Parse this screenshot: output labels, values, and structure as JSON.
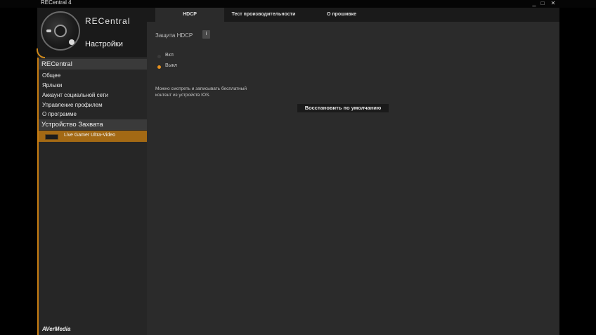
{
  "window": {
    "title": "RECentral 4",
    "minimize": "_",
    "maximize": "□",
    "close": "✕"
  },
  "sidebar": {
    "brand": "RECentral",
    "section_title": "Настройки",
    "group1": {
      "title": "RECentral",
      "items": [
        "Общее",
        "Ярлыки",
        "Аккаунт социальной сети",
        "Управление профилем",
        "О программе"
      ]
    },
    "group2": {
      "title": "Устройство Захвата",
      "device": "Live Gamer Ultra-Video"
    },
    "footer_logo": "AVerMedia"
  },
  "tabs": [
    "HDCP",
    "Тест производительности",
    "О прошивке"
  ],
  "hdcp": {
    "label": "Защита HDCP",
    "info": "i",
    "options": [
      {
        "label": "Вкл",
        "selected": false
      },
      {
        "label": "Выкл",
        "selected": true
      }
    ],
    "description_line1": "Можно смотреть и записывать бесплатный",
    "description_line2": "контент из устройств IOS.",
    "reset_button": "Восстановить по умолчанию"
  },
  "colors": {
    "accent": "#c87d12",
    "device_highlight": "#a36914",
    "background": "#2b2b2b"
  }
}
